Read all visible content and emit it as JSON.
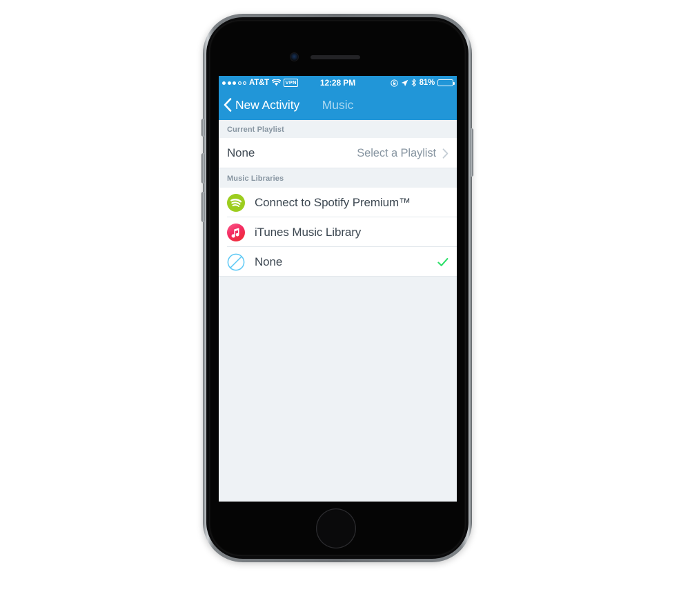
{
  "status_bar": {
    "signal_dots_filled": 3,
    "signal_dots_total": 5,
    "carrier": "AT&T",
    "wifi_icon": "wifi-icon",
    "vpn_badge": "VPN",
    "time": "12:28 PM",
    "rotation_lock_icon": "rotation-lock-icon",
    "location_icon": "location-arrow-icon",
    "bluetooth_icon": "bluetooth-icon",
    "battery_percent": "81%",
    "battery_level": 81
  },
  "nav_bar": {
    "back_icon": "chevron-left-icon",
    "back_label": "New Activity",
    "title": "Music"
  },
  "sections": [
    {
      "header": "Current Playlist",
      "rows": [
        {
          "title": "None",
          "detail": "Select a Playlist",
          "disclosure_icon": "chevron-right-icon"
        }
      ]
    },
    {
      "header": "Music Libraries",
      "rows": [
        {
          "icon": "spotify-icon",
          "title": "Connect to Spotify Premium™",
          "selected": false
        },
        {
          "icon": "itunes-music-icon",
          "title": "iTunes Music Library",
          "selected": false
        },
        {
          "icon": "none-slash-circle-icon",
          "title": "None",
          "selected": true,
          "check_icon": "checkmark-icon"
        }
      ]
    }
  ],
  "colors": {
    "nav_blue": "#2196d8",
    "background": "#eef2f5",
    "cell_white": "#ffffff",
    "header_text": "#8795a1",
    "title_text": "#3d4852",
    "checkmark_green": "#2ee06a",
    "spotify_green": "#9ccd1e",
    "itunes_pink": "#f43d72",
    "none_blue": "#5bc8f5"
  },
  "device": {
    "front_camera_icon": "front-camera-icon",
    "ear_speaker_icon": "ear-speaker-icon",
    "home_button_icon": "home-button-icon",
    "silent_switch": "silent-switch-button",
    "volume_up": "volume-up-button",
    "volume_down": "volume-down-button",
    "power": "power-button"
  }
}
